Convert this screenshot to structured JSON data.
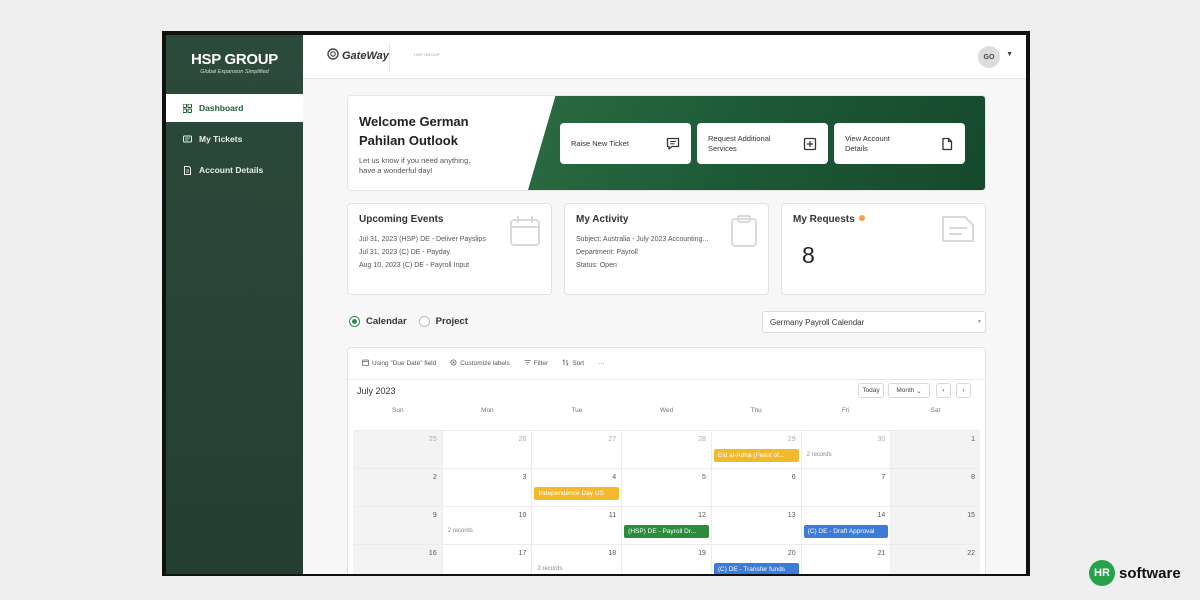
{
  "brand": {
    "name": "HSP GROUP",
    "tagline": "Global Expansion Simplified"
  },
  "sidebar": {
    "items": [
      {
        "label": "Dashboard",
        "icon": "grid-icon",
        "active": true
      },
      {
        "label": "My Tickets",
        "icon": "ticket-icon",
        "active": false
      },
      {
        "label": "Account Details",
        "icon": "document-icon",
        "active": false
      }
    ]
  },
  "topbar": {
    "logo": "GateWay",
    "hsp_mini": "HSP GROUP",
    "user_initials": "GO"
  },
  "welcome": {
    "title_line1": "Welcome German",
    "title_line2": "Pahilan Outlook",
    "sub_line1": "Let us know if you need anything,",
    "sub_line2": "have a wonderful day!",
    "actions": [
      {
        "line1": "Raise New Ticket",
        "line2": "",
        "icon": "chat-icon"
      },
      {
        "line1": "Request Additional",
        "line2": "Services",
        "icon": "plus-box-icon"
      },
      {
        "line1": "View Account",
        "line2": "Details",
        "icon": "file-icon"
      }
    ]
  },
  "upcoming": {
    "title": "Upcoming Events",
    "lines": [
      "Jul 31, 2023 (HSP) DE - Deliver Payslips",
      "Jul 31, 2023 (C) DE - Payday",
      "Aug 10, 2023 (C) DE - Payroll Input"
    ]
  },
  "activity": {
    "title": "My Activity",
    "lines": [
      "Subject:  Australia - July 2023 Accounting...",
      "Department:  Payroll",
      "Status:  Open"
    ]
  },
  "requests": {
    "title": "My Requests",
    "count": "8"
  },
  "view_toggle": {
    "calendar": "Calendar",
    "project": "Project"
  },
  "calendar_select": {
    "value": "Germany Payroll Calendar"
  },
  "calendar": {
    "toolbar": {
      "due_date": "Using \"Due Date\" field",
      "customize": "Customize labels",
      "filter": "Filter",
      "sort": "Sort",
      "more": "···"
    },
    "month_label": "July 2023",
    "today_btn": "Today",
    "view_btn": "Month",
    "prev": "‹",
    "next": "›",
    "days_of_week": [
      "Sun",
      "Mon",
      "Tue",
      "Wed",
      "Thu",
      "Fri",
      "Sat"
    ],
    "weeks": [
      [
        {
          "num": "25",
          "other": true
        },
        {
          "num": "26",
          "other": true
        },
        {
          "num": "27",
          "other": true
        },
        {
          "num": "28",
          "other": true
        },
        {
          "num": "29",
          "other": true
        },
        {
          "num": "30",
          "other": true,
          "records": "2 records"
        },
        {
          "num": "1"
        }
      ],
      [
        {
          "num": "2"
        },
        {
          "num": "3"
        },
        {
          "num": "4"
        },
        {
          "num": "5"
        },
        {
          "num": "6"
        },
        {
          "num": "7"
        },
        {
          "num": "8"
        }
      ],
      [
        {
          "num": "9"
        },
        {
          "num": "10",
          "records": "2 records"
        },
        {
          "num": "11"
        },
        {
          "num": "12"
        },
        {
          "num": "13"
        },
        {
          "num": "14"
        },
        {
          "num": "15"
        }
      ],
      [
        {
          "num": "16"
        },
        {
          "num": "17"
        },
        {
          "num": "18",
          "records": "2 records"
        },
        {
          "num": "19"
        },
        {
          "num": "20"
        },
        {
          "num": "21"
        },
        {
          "num": "22"
        }
      ]
    ],
    "events": [
      {
        "label": "Eid al-Adha (Feast of...",
        "week": 0,
        "day": 4,
        "color": "#f1b92b"
      },
      {
        "label": "Independence Day US",
        "week": 1,
        "day": 2,
        "color": "#f1b92b"
      },
      {
        "label": "(HSP) DE - Payroll Dr...",
        "week": 2,
        "day": 3,
        "color": "#2c8c3c"
      },
      {
        "label": "(C) DE - Draft Approval",
        "week": 2,
        "day": 5,
        "color": "#3d7bd8"
      },
      {
        "label": "(C) DE - Transfer funds",
        "week": 3,
        "day": 4,
        "color": "#3d7bd8"
      }
    ]
  },
  "watermark": {
    "badge": "HR",
    "text": "software"
  }
}
